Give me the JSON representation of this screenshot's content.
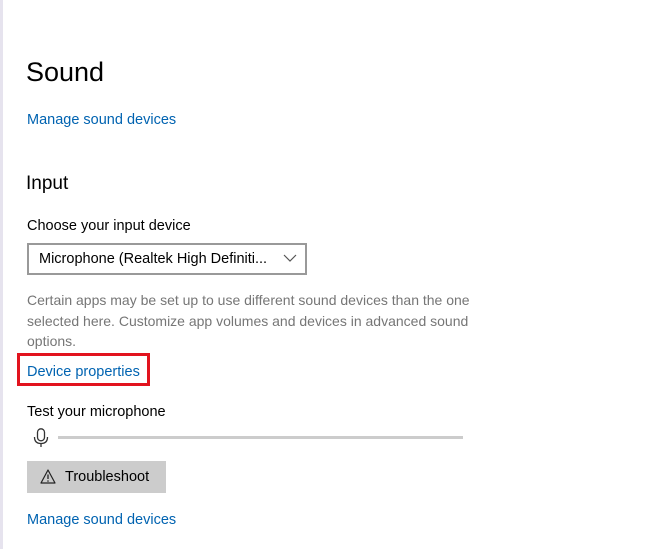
{
  "page": {
    "title": "Sound"
  },
  "links": {
    "manage_top": "Manage sound devices",
    "device_properties": "Device properties",
    "manage_bottom": "Manage sound devices"
  },
  "input": {
    "heading": "Input",
    "choose_label": "Choose your input device",
    "selected_device": "Microphone (Realtek High Definiti...",
    "help_text": "Certain apps may be set up to use different sound devices than the one selected here. Customize app volumes and devices in advanced sound options.",
    "test_label": "Test your microphone",
    "mic_level_percent": 0,
    "troubleshoot_label": "Troubleshoot"
  },
  "icons": {
    "dropdown": "chevron-down-icon",
    "microphone": "microphone-icon",
    "troubleshoot": "warning-icon"
  },
  "colors": {
    "link": "#0063b1",
    "highlight": "#e2131e",
    "button_bg": "#cccccc",
    "help_text": "#767676"
  }
}
